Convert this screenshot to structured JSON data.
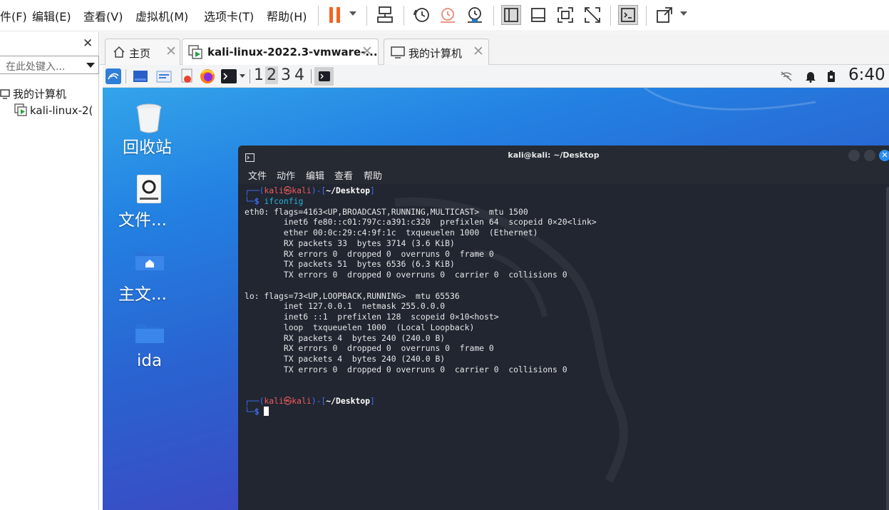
{
  "menubar": {
    "items": [
      "件(F)",
      "编辑(E)",
      "查看(V)",
      "虚拟机(M)",
      "选项卡(T)",
      "帮助(H)"
    ],
    "toolbar_icons": [
      "pause-icon",
      "send-ctrl-alt-del-icon",
      "snapshot-icon",
      "revert-snapshot-icon",
      "snapshot-manager-icon",
      "library-view-icon",
      "thumbnail-bar-icon",
      "full-screen-icon",
      "unity-icon",
      "console-view-icon",
      "stretch-icon"
    ]
  },
  "sidebar": {
    "search_placeholder": "在此处键入...",
    "tree": {
      "root": "我的计算机",
      "child": "kali-linux-2("
    }
  },
  "tabs": [
    {
      "label": "主页",
      "icon": "home-icon",
      "active": false
    },
    {
      "label": "kali-linux-2022.3-vmware-...",
      "icon": "vm-icon",
      "active": true
    },
    {
      "label": "我的计算机",
      "icon": "monitor-icon",
      "active": false
    }
  ],
  "kali_panel": {
    "workspaces": [
      "1",
      "2",
      "3",
      "4"
    ],
    "active_workspace": "2",
    "clock": "6:40"
  },
  "desktop_icons": [
    {
      "label": "回收站",
      "icon": "trash-icon"
    },
    {
      "label": "文件...",
      "icon": "drive-icon"
    },
    {
      "label": "主文...",
      "icon": "home-folder-icon"
    },
    {
      "label": "ida",
      "icon": "folder-icon"
    }
  ],
  "terminal": {
    "title": "kali@kali: ~/Desktop",
    "menu": [
      "文件",
      "动作",
      "编辑",
      "查看",
      "帮助"
    ],
    "prompt_user": "kali",
    "prompt_at": "㉿",
    "prompt_host": "kali",
    "prompt_dir": "~/Desktop",
    "command": "ifconfig",
    "output": [
      "eth0: flags=4163<UP,BROADCAST,RUNNING,MULTICAST>  mtu 1500",
      "        inet6 fe80::c01:797c:a391:c320  prefixlen 64  scopeid 0×20<link>",
      "        ether 00:0c:29:c4:9f:1c  txqueuelen 1000  (Ethernet)",
      "        RX packets 33  bytes 3714 (3.6 KiB)",
      "        RX errors 0  dropped 0  overruns 0  frame 0",
      "        TX packets 51  bytes 6536 (6.3 KiB)",
      "        TX errors 0  dropped 0 overruns 0  carrier 0  collisions 0",
      "",
      "lo: flags=73<UP,LOOPBACK,RUNNING>  mtu 65536",
      "        inet 127.0.0.1  netmask 255.0.0.0",
      "        inet6 ::1  prefixlen 128  scopeid 0×10<host>",
      "        loop  txqueuelen 1000  (Local Loopback)",
      "        RX packets 4  bytes 240 (240.0 B)",
      "        RX errors 0  dropped 0  overruns 0  frame 0",
      "        TX packets 4  bytes 240 (240.0 B)",
      "        TX errors 0  dropped 0 overruns 0  carrier 0  collisions 0"
    ]
  },
  "colors": {
    "prompt_frame": "#3f6ef0",
    "prompt_user": "#ef5b5b",
    "command": "#29b3d8",
    "terminal_bg": "#212631"
  }
}
